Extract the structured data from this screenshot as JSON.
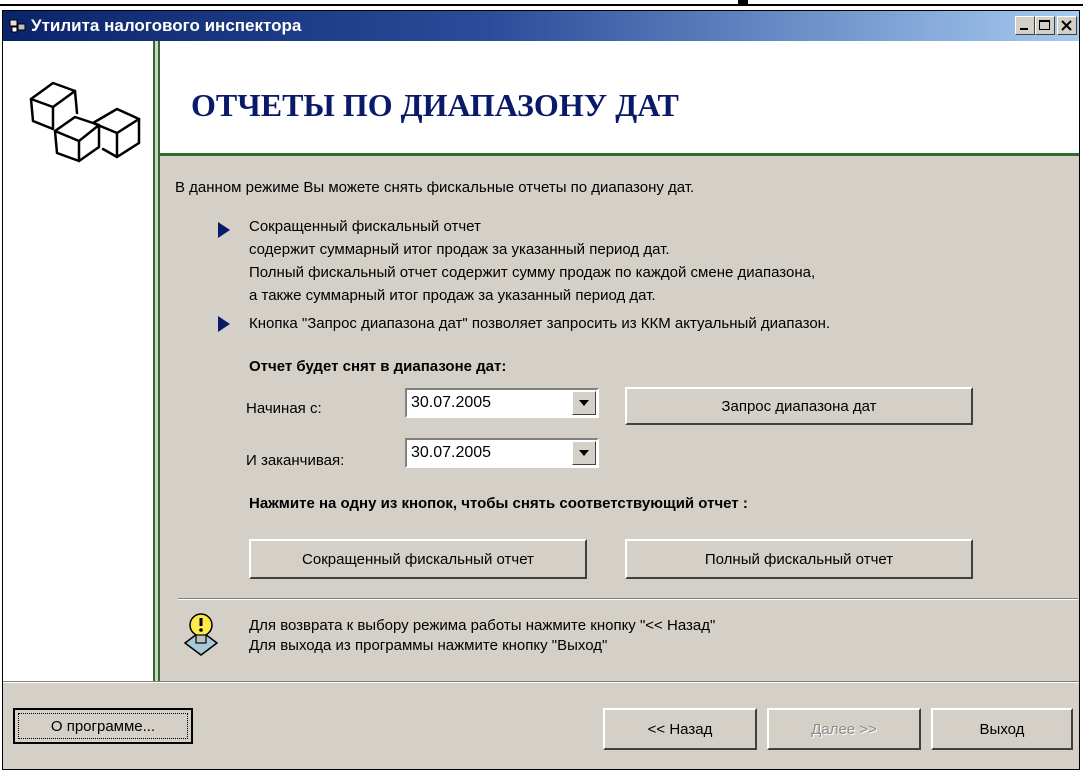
{
  "window": {
    "title": "Утилита налогового инспектора"
  },
  "header": {
    "title": "ОТЧЕТЫ ПО ДИАПАЗОНУ ДАТ"
  },
  "intro": "В данном режиме Вы можете снять фискальные отчеты по диапазону дат.",
  "bullets": [
    {
      "lines": [
        "Сокращенный фискальный отчет",
        "содержит суммарный итог продаж за указанный период дат.",
        "Полный фискальный отчет содержит сумму продаж по каждой смене  диапазона,",
        "а также суммарный итог продаж за указанный период дат."
      ]
    },
    {
      "lines": [
        "Кнопка \"Запрос диапазона дат\" позволяет запросить из ККМ актуальный диапазон."
      ]
    }
  ],
  "range": {
    "heading": "Отчет будет снят в диапазоне дат:",
    "start_label": "Начиная с:",
    "start_value": "30.07.2005",
    "end_label": "И заканчивая:",
    "end_value": "30.07.2005",
    "request_button": "Запрос диапазона дат"
  },
  "reports": {
    "heading": "Нажмите на одну из кнопок, чтобы снять соответствующий отчет :",
    "short_button": "Сокращенный фискальный отчет",
    "full_button": "Полный фискальный отчет"
  },
  "hint": {
    "lines": [
      "Для возврата к выбору режима работы нажмите кнопку \"<< Назад\"",
      "Для выхода из программы нажмите кнопку \"Выход\""
    ]
  },
  "footer": {
    "about_button": "О программе...",
    "back_button": "<< Назад",
    "next_button": "Далее >>",
    "exit_button": "Выход"
  },
  "colors": {
    "accent": "#0a1a6a",
    "divider": "#2f6b2f",
    "face": "#d4d0c8",
    "titlebar": "#0a246a"
  }
}
